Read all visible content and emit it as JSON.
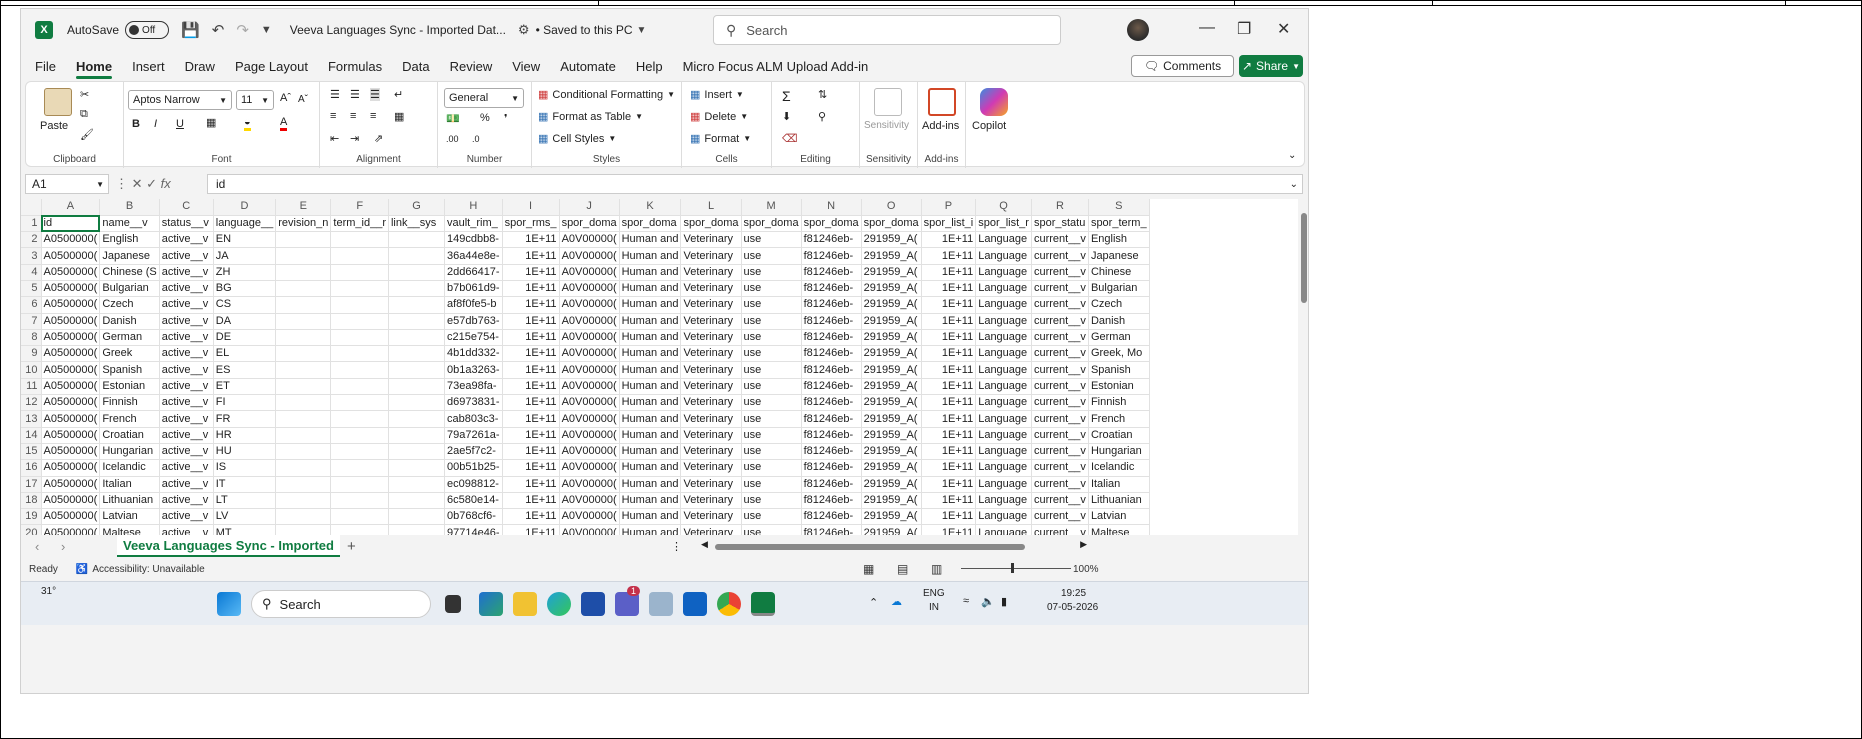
{
  "window": {
    "autosave_label": "AutoSave",
    "autosave_state": "Off",
    "title": "Veeva Languages Sync - Imported Dat...",
    "saved_status": "• Saved to this PC",
    "search_placeholder": "Search"
  },
  "menu": [
    "File",
    "Home",
    "Insert",
    "Draw",
    "Page Layout",
    "Formulas",
    "Data",
    "Review",
    "View",
    "Automate",
    "Help",
    "Micro Focus ALM Upload Add-in"
  ],
  "buttons": {
    "comments": "Comments",
    "share": "Share"
  },
  "ribbon": {
    "clipboard": {
      "label": "Clipboard",
      "paste": "Paste"
    },
    "font": {
      "label": "Font",
      "name": "Aptos Narrow",
      "size": "11",
      "bold": "B",
      "italic": "I",
      "underline": "U"
    },
    "alignment": {
      "label": "Alignment"
    },
    "number": {
      "label": "Number",
      "format": "General"
    },
    "styles": {
      "label": "Styles",
      "conditional": "Conditional Formatting",
      "table": "Format as Table",
      "cell_styles": "Cell Styles"
    },
    "cells": {
      "label": "Cells",
      "insert": "Insert",
      "delete": "Delete",
      "format": "Format"
    },
    "editing": {
      "label": "Editing"
    },
    "sensitivity": {
      "label": "Sensitivity",
      "btn": "Sensitivity"
    },
    "addins": {
      "label": "Add-ins",
      "btn": "Add-ins"
    },
    "copilot": {
      "btn": "Copilot"
    }
  },
  "formula_bar": {
    "name_box": "A1",
    "fx": "fx",
    "value": "id"
  },
  "columns": [
    "A",
    "B",
    "C",
    "D",
    "E",
    "F",
    "G",
    "H",
    "I",
    "J",
    "K",
    "L",
    "M",
    "N",
    "O",
    "P",
    "Q",
    "R",
    "S"
  ],
  "rows": [
    [
      "1",
      "id",
      "name__v",
      "status__v",
      "language__",
      "revision_n",
      "term_id__r",
      "link__sys",
      "vault_rim_",
      "spor_rms_",
      "spor_doma",
      "spor_doma",
      "spor_doma",
      "spor_doma",
      "spor_doma",
      "spor_doma",
      "spor_list_i",
      "spor_list_r",
      "spor_statu",
      "spor_term_"
    ],
    [
      "2",
      "A0500000(",
      "English",
      "active__v",
      "EN",
      "",
      "",
      "",
      "149cdbb8-",
      "1E+11",
      "A0V00000(",
      "Human and",
      "Veterinary",
      "use",
      "f81246eb-",
      "291959_A(",
      "1E+11",
      "Language",
      "current__v",
      "English"
    ],
    [
      "3",
      "A0500000(",
      "Japanese",
      "active__v",
      "JA",
      "",
      "",
      "",
      "36a44e8e-",
      "1E+11",
      "A0V00000(",
      "Human and",
      "Veterinary",
      "use",
      "f81246eb-",
      "291959_A(",
      "1E+11",
      "Language",
      "current__v",
      "Japanese"
    ],
    [
      "4",
      "A0500000(",
      "Chinese (S",
      "active__v",
      "ZH",
      "",
      "",
      "",
      "2dd66417-",
      "1E+11",
      "A0V00000(",
      "Human and",
      "Veterinary",
      "use",
      "f81246eb-",
      "291959_A(",
      "1E+11",
      "Language",
      "current__v",
      "Chinese"
    ],
    [
      "5",
      "A0500000(",
      "Bulgarian",
      "active__v",
      "BG",
      "",
      "",
      "",
      "b7b061d9-",
      "1E+11",
      "A0V00000(",
      "Human and",
      "Veterinary",
      "use",
      "f81246eb-",
      "291959_A(",
      "1E+11",
      "Language",
      "current__v",
      "Bulgarian"
    ],
    [
      "6",
      "A0500000(",
      "Czech",
      "active__v",
      "CS",
      "",
      "",
      "",
      "af8f0fe5-b",
      "1E+11",
      "A0V00000(",
      "Human and",
      "Veterinary",
      "use",
      "f81246eb-",
      "291959_A(",
      "1E+11",
      "Language",
      "current__v",
      "Czech"
    ],
    [
      "7",
      "A0500000(",
      "Danish",
      "active__v",
      "DA",
      "",
      "",
      "",
      "e57db763-",
      "1E+11",
      "A0V00000(",
      "Human and",
      "Veterinary",
      "use",
      "f81246eb-",
      "291959_A(",
      "1E+11",
      "Language",
      "current__v",
      "Danish"
    ],
    [
      "8",
      "A0500000(",
      "German",
      "active__v",
      "DE",
      "",
      "",
      "",
      "c215e754-",
      "1E+11",
      "A0V00000(",
      "Human and",
      "Veterinary",
      "use",
      "f81246eb-",
      "291959_A(",
      "1E+11",
      "Language",
      "current__v",
      "German"
    ],
    [
      "9",
      "A0500000(",
      "Greek",
      "active__v",
      "EL",
      "",
      "",
      "",
      "4b1dd332-",
      "1E+11",
      "A0V00000(",
      "Human and",
      "Veterinary",
      "use",
      "f81246eb-",
      "291959_A(",
      "1E+11",
      "Language",
      "current__v",
      "Greek, Mo"
    ],
    [
      "10",
      "A0500000(",
      "Spanish",
      "active__v",
      "ES",
      "",
      "",
      "",
      "0b1a3263-",
      "1E+11",
      "A0V00000(",
      "Human and",
      "Veterinary",
      "use",
      "f81246eb-",
      "291959_A(",
      "1E+11",
      "Language",
      "current__v",
      "Spanish"
    ],
    [
      "11",
      "A0500000(",
      "Estonian",
      "active__v",
      "ET",
      "",
      "",
      "",
      "73ea98fa-",
      "1E+11",
      "A0V00000(",
      "Human and",
      "Veterinary",
      "use",
      "f81246eb-",
      "291959_A(",
      "1E+11",
      "Language",
      "current__v",
      "Estonian"
    ],
    [
      "12",
      "A0500000(",
      "Finnish",
      "active__v",
      "FI",
      "",
      "",
      "",
      "d6973831-",
      "1E+11",
      "A0V00000(",
      "Human and",
      "Veterinary",
      "use",
      "f81246eb-",
      "291959_A(",
      "1E+11",
      "Language",
      "current__v",
      "Finnish"
    ],
    [
      "13",
      "A0500000(",
      "French",
      "active__v",
      "FR",
      "",
      "",
      "",
      "cab803c3-",
      "1E+11",
      "A0V00000(",
      "Human and",
      "Veterinary",
      "use",
      "f81246eb-",
      "291959_A(",
      "1E+11",
      "Language",
      "current__v",
      "French"
    ],
    [
      "14",
      "A0500000(",
      "Croatian",
      "active__v",
      "HR",
      "",
      "",
      "",
      "79a7261a-",
      "1E+11",
      "A0V00000(",
      "Human and",
      "Veterinary",
      "use",
      "f81246eb-",
      "291959_A(",
      "1E+11",
      "Language",
      "current__v",
      "Croatian"
    ],
    [
      "15",
      "A0500000(",
      "Hungarian",
      "active__v",
      "HU",
      "",
      "",
      "",
      "2ae5f7c2-",
      "1E+11",
      "A0V00000(",
      "Human and",
      "Veterinary",
      "use",
      "f81246eb-",
      "291959_A(",
      "1E+11",
      "Language",
      "current__v",
      "Hungarian"
    ],
    [
      "16",
      "A0500000(",
      "Icelandic",
      "active__v",
      "IS",
      "",
      "",
      "",
      "00b51b25-",
      "1E+11",
      "A0V00000(",
      "Human and",
      "Veterinary",
      "use",
      "f81246eb-",
      "291959_A(",
      "1E+11",
      "Language",
      "current__v",
      "Icelandic"
    ],
    [
      "17",
      "A0500000(",
      "Italian",
      "active__v",
      "IT",
      "",
      "",
      "",
      "ec098812-",
      "1E+11",
      "A0V00000(",
      "Human and",
      "Veterinary",
      "use",
      "f81246eb-",
      "291959_A(",
      "1E+11",
      "Language",
      "current__v",
      "Italian"
    ],
    [
      "18",
      "A0500000(",
      "Lithuanian",
      "active__v",
      "LT",
      "",
      "",
      "",
      "6c580e14-",
      "1E+11",
      "A0V00000(",
      "Human and",
      "Veterinary",
      "use",
      "f81246eb-",
      "291959_A(",
      "1E+11",
      "Language",
      "current__v",
      "Lithuanian"
    ],
    [
      "19",
      "A0500000(",
      "Latvian",
      "active__v",
      "LV",
      "",
      "",
      "",
      "0b768cf6-",
      "1E+11",
      "A0V00000(",
      "Human and",
      "Veterinary",
      "use",
      "f81246eb-",
      "291959_A(",
      "1E+11",
      "Language",
      "current__v",
      "Latvian"
    ],
    [
      "20",
      "A0500000(",
      "Maltese",
      "active__v",
      "MT",
      "",
      "",
      "",
      "97714e46-",
      "1E+11",
      "A0V00000(",
      "Human and",
      "Veterinary",
      "use",
      "f81246eb-",
      "291959_A(",
      "1E+11",
      "Language",
      "current__v",
      "Maltese"
    ]
  ],
  "sheet_tab": "Veeva Languages Sync - Imported",
  "status": {
    "ready": "Ready",
    "accessibility": "Accessibility: Unavailable",
    "zoom": "100%"
  },
  "taskbar": {
    "weather": "31°",
    "search": "Search",
    "lang1": "ENG",
    "lang2": "IN",
    "time": "19:25",
    "date": "07-05-2026",
    "teams_badge": "1"
  },
  "colors": {
    "excel_green": "#107c41"
  }
}
